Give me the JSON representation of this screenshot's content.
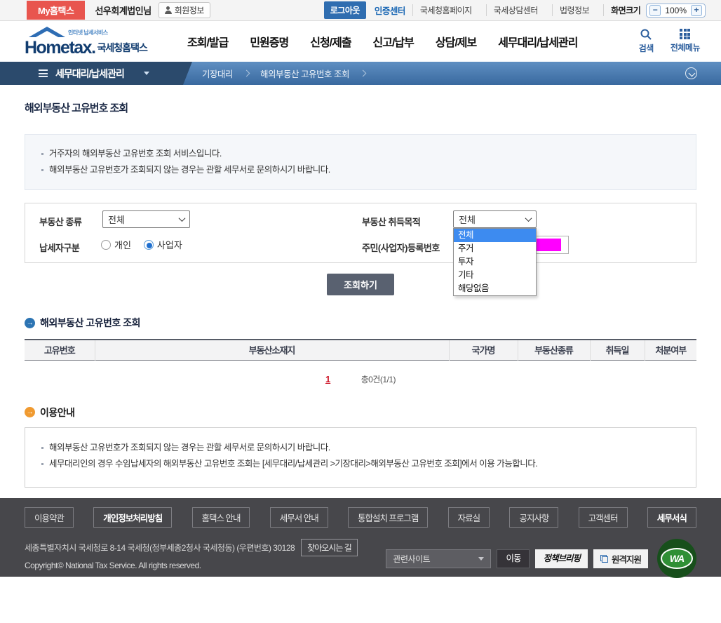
{
  "utility": {
    "my_hometax": "My홈택스",
    "user_name": "선우회계법인님",
    "member_info": "회원정보",
    "logout": "로그아웃",
    "auth_center": "인증센터",
    "links": [
      "국세청홈페이지",
      "국세상담센터",
      "법령정보"
    ],
    "screen_size_label": "화면크기",
    "zoom_minus": "−",
    "zoom_level": "100%",
    "zoom_plus": "+"
  },
  "header": {
    "logo_tagline": "인터넷 납세서비스",
    "logo_text": "Hometax.",
    "logo_kr": "국세청홈택스",
    "menus": [
      "조회/발급",
      "민원증명",
      "신청/제출",
      "신고/납부",
      "상담/제보",
      "세무대리/납세관리"
    ],
    "search_label": "검색",
    "all_menu_label": "전체메뉴"
  },
  "breadcrumb": {
    "section": "세무대리/납세관리",
    "items": [
      "기장대리",
      "해외부동산 고유번호 조회"
    ]
  },
  "page": {
    "title": "해외부동산 고유번호 조회",
    "notices": [
      "거주자의 해외부동산 고유번호 조회 서비스입니다.",
      "해외부동산 고유번호가 조회되지 않는 경우는 관할 세무서로 문의하시기 바랍니다."
    ]
  },
  "form": {
    "property_type_label": "부동산 종류",
    "property_type_value": "전체",
    "purpose_label": "부동산 취득목적",
    "purpose_value": "전체",
    "purpose_options": [
      "전체",
      "주거",
      "투자",
      "기타",
      "해당없음"
    ],
    "taxpayer_label": "납세자구분",
    "radio_individual": "개인",
    "radio_business": "사업자",
    "reg_no_label": "주민(사업자)등록번호",
    "search_button": "조회하기"
  },
  "results": {
    "section_title": "해외부동산 고유번호 조회",
    "columns": [
      "고유번호",
      "부동산소재지",
      "국가명",
      "부동산종류",
      "취득일",
      "처분여부"
    ],
    "page_number": "1",
    "total_text": "총0건(1/1)"
  },
  "guide": {
    "title": "이용안내",
    "items": [
      "해외부동산 고유번호가 조회되지 않는 경우는 관할 세무서로 문의하시기 바랍니다.",
      "세무대리인의 경우 수임납세자의 해외부동산 고유번호 조회는 [세무대리/납세관리 >기장대리>해외부동산 고유번호 조회]에서 이용 가능합니다."
    ]
  },
  "footer": {
    "links": [
      "이용약관",
      "개인정보처리방침",
      "홈택스 안내",
      "세무서 안내",
      "통합설치 프로그램",
      "자료실",
      "공지사항",
      "고객센터",
      "세무서식"
    ],
    "address": "세종특별자치시 국세청로 8-14 국세청(정부세종2청사 국세청동) (우편번호) 30128",
    "directions": "찾아오시는 길",
    "related_sites": "관련사이트",
    "go_button": "이동",
    "policy_briefing": "정책브리핑",
    "remote_support": "원격지원",
    "copyright": "Copyright© National Tax Service. All rights reserved.",
    "wa_label": "WA"
  },
  "icons": {
    "arrow_right": "→"
  },
  "colors": {
    "accent_red": "#e8554e",
    "accent_blue": "#2f6db0",
    "lnb_dark": "#2b4a6c",
    "mask_magenta": "#ff00ff",
    "footer_bg": "#47474b"
  }
}
